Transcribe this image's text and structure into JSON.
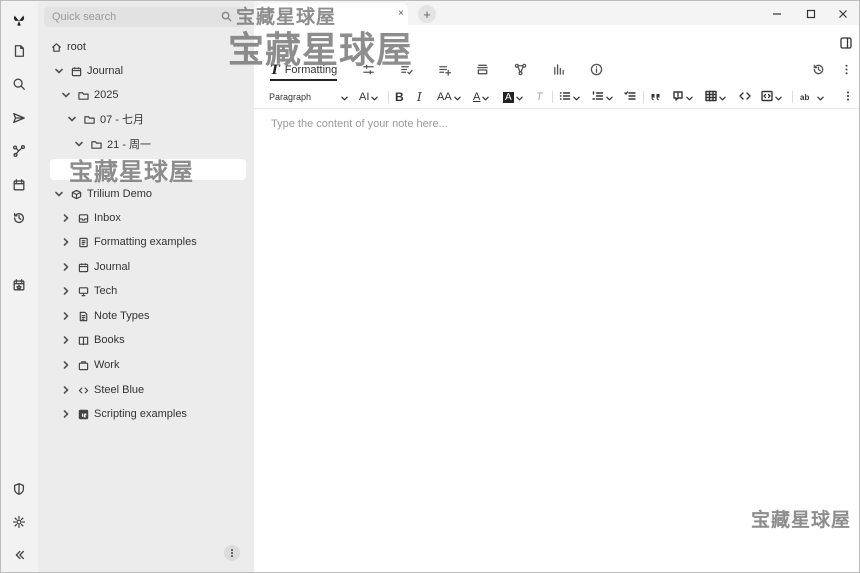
{
  "search": {
    "placeholder": "Quick search"
  },
  "tree": {
    "nodes": [
      {
        "label": "root",
        "icon": "home-icon",
        "expanded": true
      },
      {
        "label": "Journal",
        "icon": "calendar-icon",
        "expanded": true
      },
      {
        "label": "2025",
        "icon": "folder-icon",
        "expanded": true
      },
      {
        "label": "07 - 七月",
        "icon": "folder-icon",
        "expanded": true
      },
      {
        "label": "21 - 周一",
        "icon": "folder-icon",
        "expanded": true
      },
      {
        "label": "Trilium Demo",
        "icon": "package-icon",
        "expanded": true
      },
      {
        "label": "Inbox",
        "icon": "inbox-icon",
        "expanded": false
      },
      {
        "label": "Formatting examples",
        "icon": "document-icon",
        "expanded": false
      },
      {
        "label": "Journal",
        "icon": "calendar-icon",
        "expanded": false
      },
      {
        "label": "Tech",
        "icon": "desktop-icon",
        "expanded": false
      },
      {
        "label": "Note Types",
        "icon": "file-text-icon",
        "expanded": false
      },
      {
        "label": "Books",
        "icon": "book-icon",
        "expanded": false
      },
      {
        "label": "Work",
        "icon": "briefcase-icon",
        "expanded": false
      },
      {
        "label": "Steel Blue",
        "icon": "code-icon",
        "expanded": false
      },
      {
        "label": "Scripting examples",
        "icon": "script-icon",
        "expanded": false
      }
    ]
  },
  "tabs": {
    "close": "×",
    "add": "+"
  },
  "ribbon": {
    "formatting_label": "Formatting",
    "formatting_glyph": "T"
  },
  "toolbar": {
    "heading_select": "Paragraph",
    "font_size_label": "AI",
    "bold": "B",
    "italic": "I",
    "text_size": "AA",
    "font_color": "A",
    "highlight": "A",
    "clear_formatting": "T",
    "spellcheck": "ab"
  },
  "note": {
    "placeholder": "Type the content of your note here..."
  },
  "watermark": {
    "text": "宝藏星球屋"
  }
}
